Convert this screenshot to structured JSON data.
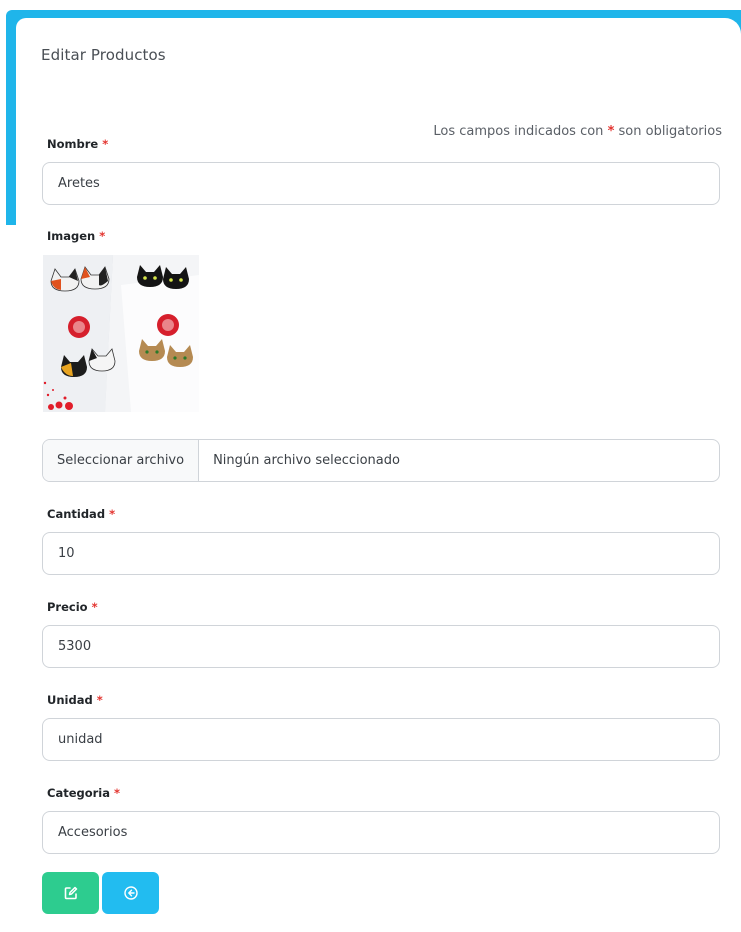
{
  "card": {
    "title": "Editar Productos",
    "required_note_prefix": "Los campos indicados con",
    "required_note_star": "*",
    "required_note_suffix": "son obligatorios"
  },
  "form": {
    "nombre": {
      "label": "Nombre",
      "value": "Aretes"
    },
    "imagen": {
      "label": "Imagen",
      "file_button": "Seleccionar archivo",
      "file_status": "Ningún archivo seleccionado"
    },
    "cantidad": {
      "label": "Cantidad",
      "value": "10"
    },
    "precio": {
      "label": "Precio",
      "value": "5300"
    },
    "unidad": {
      "label": "Unidad",
      "value": "unidad"
    },
    "categoria": {
      "label": "Categoria",
      "value": "Accesorios"
    },
    "required_star": "*"
  },
  "actions": {
    "edit_icon": "edit-icon",
    "back_icon": "circle-arrow-left-icon"
  },
  "colors": {
    "accent": "#1fb5ea",
    "edit_button": "#2dcc8f",
    "back_button": "#22bcf0",
    "required": "#e3342f"
  }
}
